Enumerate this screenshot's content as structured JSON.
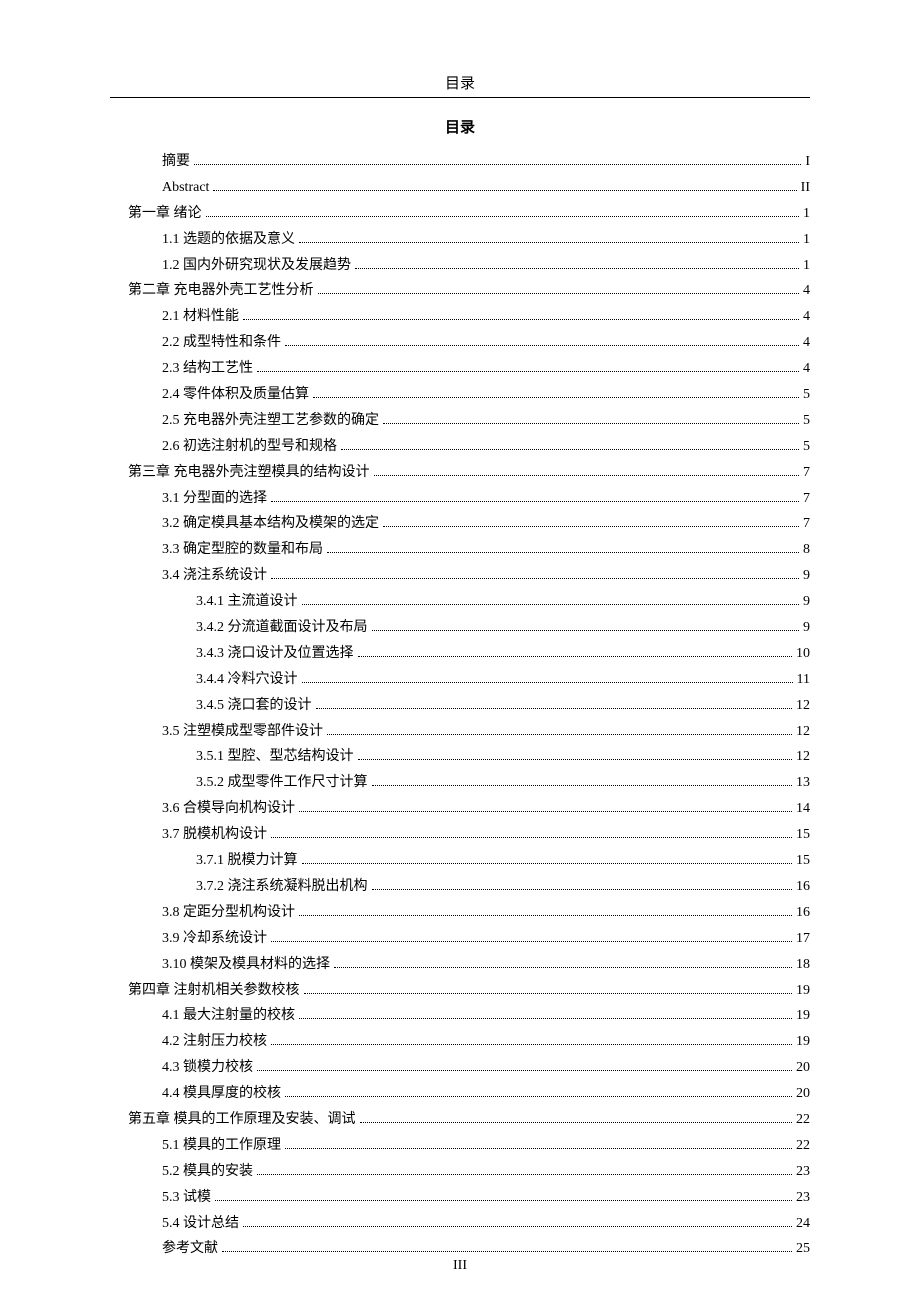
{
  "running_header": "目录",
  "title": "目录",
  "page_number": "III",
  "toc": [
    {
      "indent": "ind0",
      "label": "摘要",
      "page": "I"
    },
    {
      "indent": "ind0",
      "label": "Abstract",
      "page": "II"
    },
    {
      "indent": "ind1",
      "label": "第一章 绪论",
      "page": "1"
    },
    {
      "indent": "ind2",
      "label": "1.1 选题的依据及意义",
      "page": "1"
    },
    {
      "indent": "ind2",
      "label": "1.2 国内外研究现状及发展趋势",
      "page": "1"
    },
    {
      "indent": "ind1",
      "label": "第二章 充电器外壳工艺性分析",
      "page": "4"
    },
    {
      "indent": "ind2",
      "label": "2.1 材料性能",
      "page": "4"
    },
    {
      "indent": "ind2",
      "label": "2.2 成型特性和条件",
      "page": "4"
    },
    {
      "indent": "ind2",
      "label": "2.3 结构工艺性",
      "page": "4"
    },
    {
      "indent": "ind2",
      "label": "2.4 零件体积及质量估算",
      "page": "5"
    },
    {
      "indent": "ind2",
      "label": "2.5 充电器外壳注塑工艺参数的确定",
      "page": "5"
    },
    {
      "indent": "ind2",
      "label": "2.6 初选注射机的型号和规格",
      "page": "5"
    },
    {
      "indent": "ind1",
      "label": "第三章 充电器外壳注塑模具的结构设计",
      "page": "7"
    },
    {
      "indent": "ind2",
      "label": "3.1 分型面的选择",
      "page": "7"
    },
    {
      "indent": "ind2",
      "label": "3.2 确定模具基本结构及模架的选定",
      "page": "7"
    },
    {
      "indent": "ind2",
      "label": "3.3 确定型腔的数量和布局",
      "page": "8"
    },
    {
      "indent": "ind2",
      "label": "3.4 浇注系统设计",
      "page": "9"
    },
    {
      "indent": "ind3",
      "label": "3.4.1 主流道设计",
      "page": "9"
    },
    {
      "indent": "ind3",
      "label": "3.4.2 分流道截面设计及布局",
      "page": "9"
    },
    {
      "indent": "ind3",
      "label": "3.4.3 浇口设计及位置选择",
      "page": "10"
    },
    {
      "indent": "ind3",
      "label": "3.4.4 冷料穴设计",
      "page": "11"
    },
    {
      "indent": "ind3",
      "label": "3.4.5 浇口套的设计",
      "page": "12"
    },
    {
      "indent": "ind2",
      "label": "3.5 注塑模成型零部件设计",
      "page": "12"
    },
    {
      "indent": "ind3",
      "label": "3.5.1 型腔、型芯结构设计",
      "page": "12"
    },
    {
      "indent": "ind3",
      "label": "3.5.2 成型零件工作尺寸计算",
      "page": "13"
    },
    {
      "indent": "ind2",
      "label": "3.6 合模导向机构设计",
      "page": "14"
    },
    {
      "indent": "ind2",
      "label": "3.7 脱模机构设计",
      "page": "15"
    },
    {
      "indent": "ind3",
      "label": "3.7.1 脱模力计算",
      "page": "15"
    },
    {
      "indent": "ind3",
      "label": "3.7.2 浇注系统凝料脱出机构",
      "page": "16"
    },
    {
      "indent": "ind2",
      "label": "3.8 定距分型机构设计",
      "page": "16"
    },
    {
      "indent": "ind2",
      "label": "3.9 冷却系统设计",
      "page": "17"
    },
    {
      "indent": "ind2",
      "label": "3.10 模架及模具材料的选择",
      "page": "18"
    },
    {
      "indent": "ind1",
      "label": "第四章 注射机相关参数校核",
      "page": "19"
    },
    {
      "indent": "ind2",
      "label": "4.1 最大注射量的校核",
      "page": "19"
    },
    {
      "indent": "ind2",
      "label": "4.2 注射压力校核",
      "page": "19"
    },
    {
      "indent": "ind2",
      "label": "4.3 锁模力校核",
      "page": "20"
    },
    {
      "indent": "ind2",
      "label": "4.4 模具厚度的校核",
      "page": "20"
    },
    {
      "indent": "ind1",
      "label": "第五章 模具的工作原理及安装、调试",
      "page": "22"
    },
    {
      "indent": "ind2",
      "label": "5.1 模具的工作原理",
      "page": "22"
    },
    {
      "indent": "ind2",
      "label": "5.2 模具的安装",
      "page": "23"
    },
    {
      "indent": "ind2",
      "label": "5.3 试模",
      "page": "23"
    },
    {
      "indent": "ind2",
      "label": "5.4 设计总结",
      "page": "24"
    },
    {
      "indent": "ind2",
      "label": "参考文献",
      "page": "25"
    }
  ]
}
